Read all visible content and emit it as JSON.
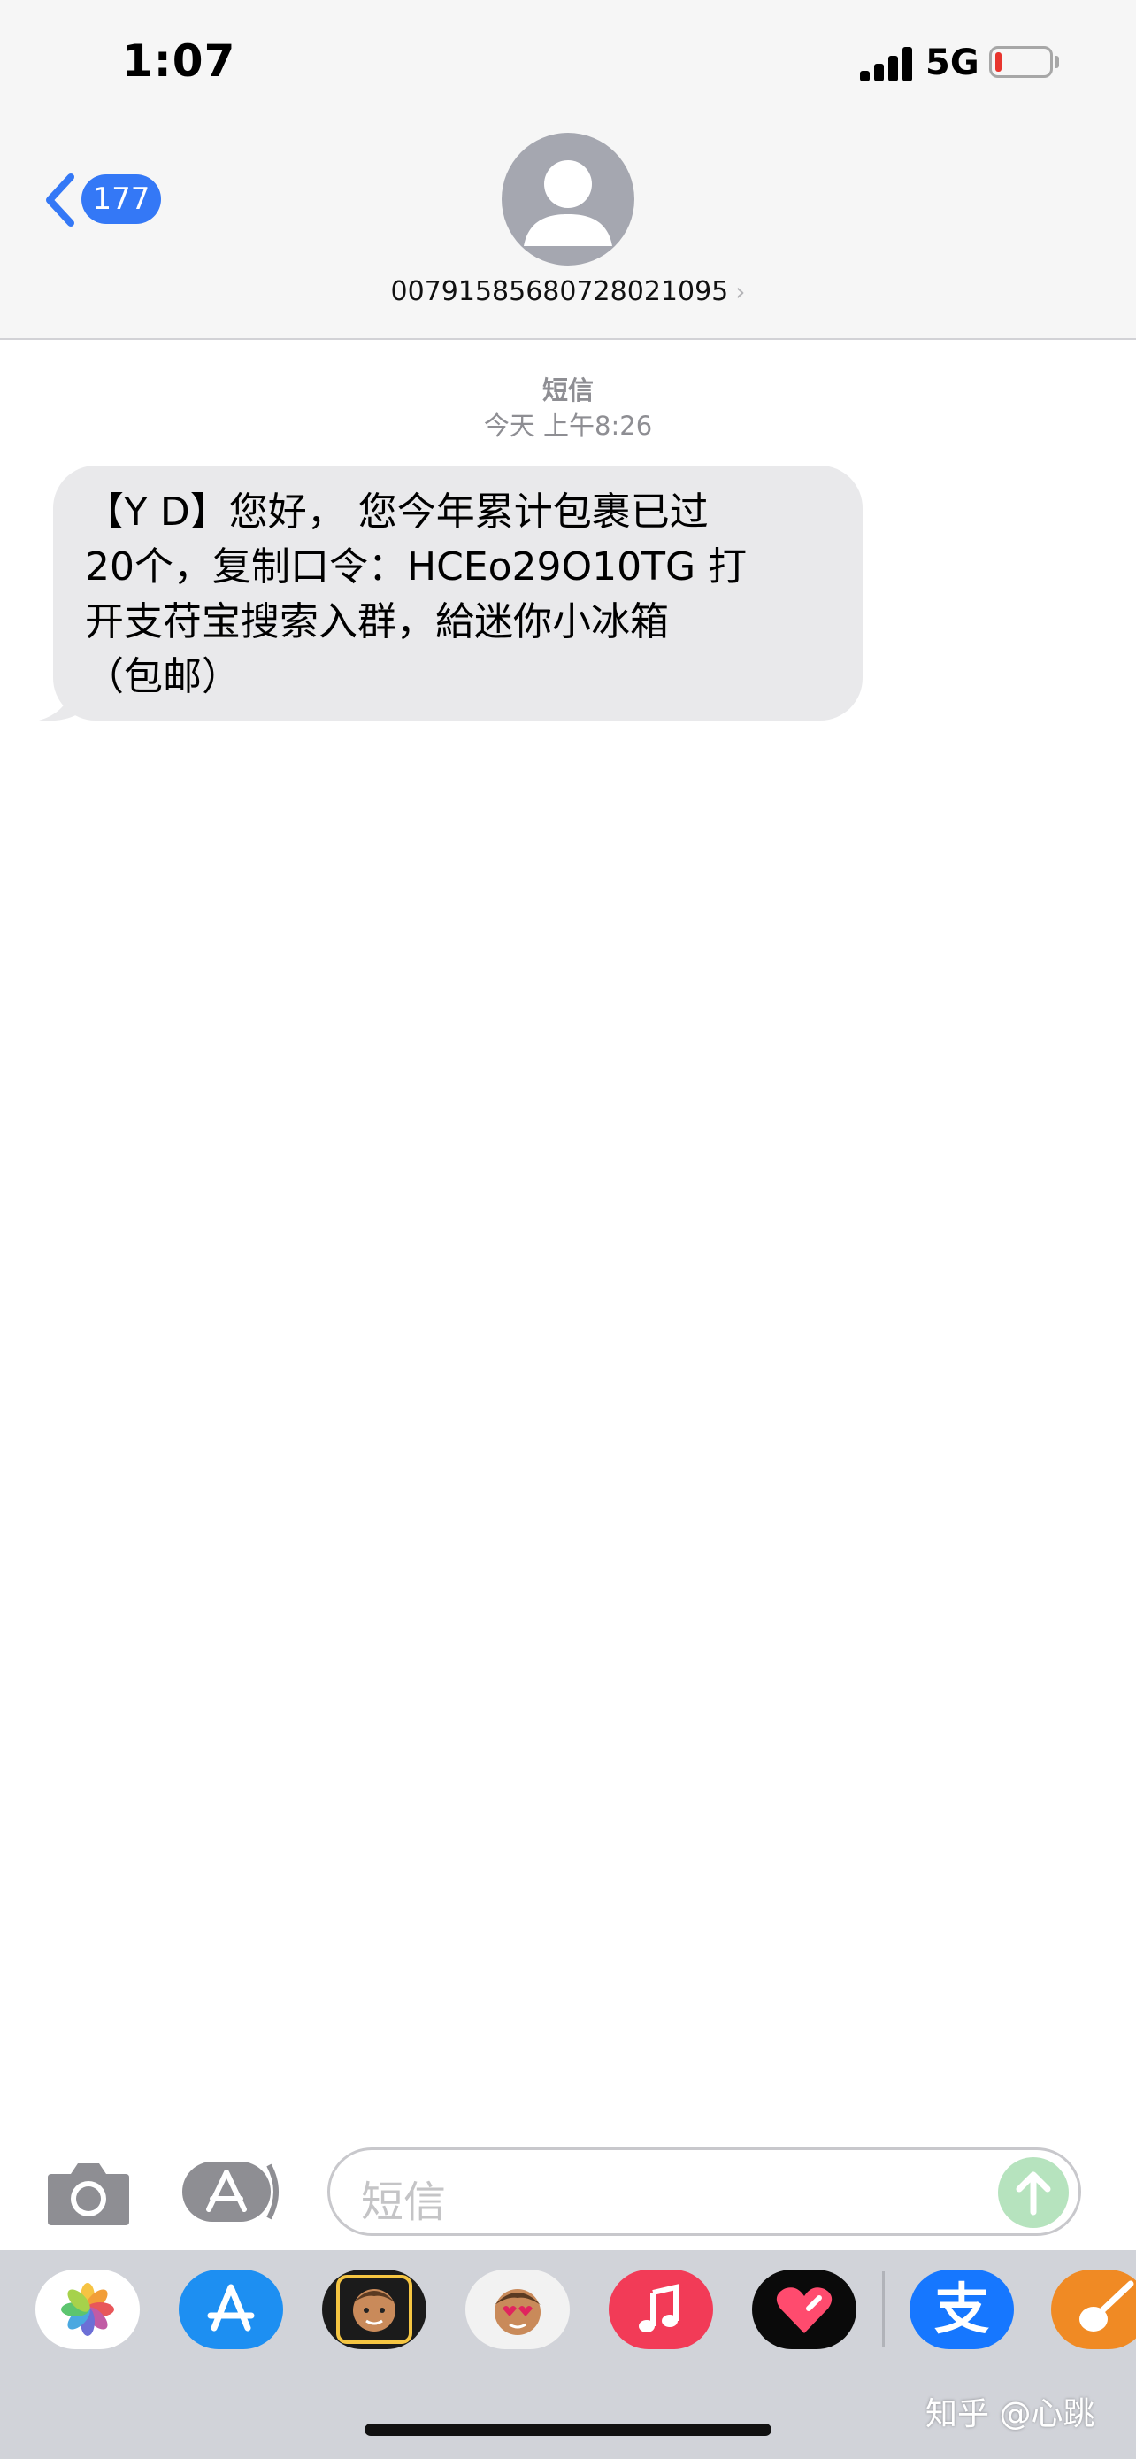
{
  "status_bar": {
    "time": "1:07",
    "network": "5G",
    "battery_level": 0.12
  },
  "header": {
    "back_badge": "177",
    "contact_number": "00791585680728021095",
    "chevron": "›"
  },
  "conversation": {
    "service_label": "短信",
    "timestamp": "今天 上午8:26",
    "message_lines": [
      "【Y D】您好， 您今年累计包裹已过",
      "20个，复制口令：HCEo29O10TG 打",
      "开支苻宝搜索入群，給迷你小冰箱",
      "（包邮）"
    ]
  },
  "input": {
    "placeholder": "短信"
  },
  "app_drawer": {
    "apps": [
      "photos-icon",
      "app-store-icon",
      "memoji-camera-icon",
      "memoji-stickers-icon",
      "music-icon",
      "digital-touch-icon",
      "alipay-icon",
      "garageband-icon"
    ],
    "alipay_glyph": "支"
  },
  "watermark": "知乎 @心跳",
  "colors": {
    "accent": "#3478f6",
    "bubble": "#e9e9eb",
    "send_disabled": "#b6e3be"
  }
}
